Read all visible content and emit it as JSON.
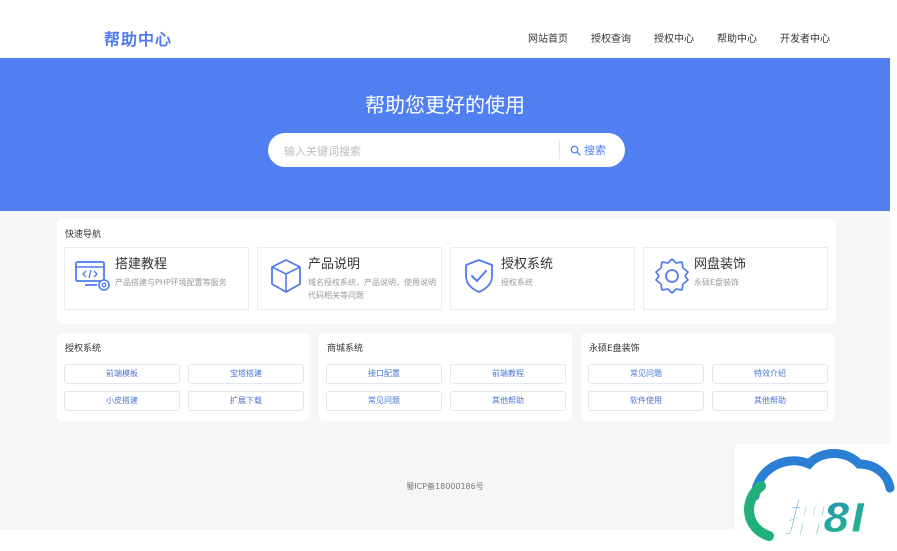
{
  "header": {
    "brand": "帮助中心",
    "nav": [
      "网站首页",
      "授权查询",
      "授权中心",
      "帮助中心",
      "开发者中心"
    ]
  },
  "hero": {
    "title": "帮助您更好的使用",
    "search_placeholder": "输入关键词搜索",
    "search_button": "搜索"
  },
  "quick_nav": {
    "title": "快速导航",
    "items": [
      {
        "title": "搭建教程",
        "desc": "产品搭建与PHP环境配置等服务",
        "icon": "computer-settings-icon"
      },
      {
        "title": "产品说明",
        "desc": "域名授权系统，产品说明，使用说明代码相关等问题",
        "icon": "box-icon"
      },
      {
        "title": "授权系统",
        "desc": "授权系统",
        "icon": "shield-check-icon"
      },
      {
        "title": "网盘装饰",
        "desc": "永硕E盘装饰",
        "icon": "gear-icon"
      }
    ]
  },
  "sections": [
    {
      "title": "授权系统",
      "links": [
        "前端模板",
        "宝塔搭建",
        "小皮搭建",
        "扩展下载"
      ]
    },
    {
      "title": "商城系统",
      "links": [
        "接口配置",
        "前端教程",
        "常见问题",
        "其他帮助"
      ]
    },
    {
      "title": "永硕E盘装饰",
      "links": [
        "常见问题",
        "特效介绍",
        "软件使用",
        "其他帮助"
      ]
    }
  ],
  "footer": {
    "icp": "蜀ICP备18000186号"
  },
  "watermark": {
    "text": "撸8I",
    "icon": "cloud-logo-icon"
  },
  "colors": {
    "accent": "#507ff1",
    "brand": "#4f7cf0",
    "link": "#4a76d6",
    "watermark": "#1fb3c8"
  }
}
